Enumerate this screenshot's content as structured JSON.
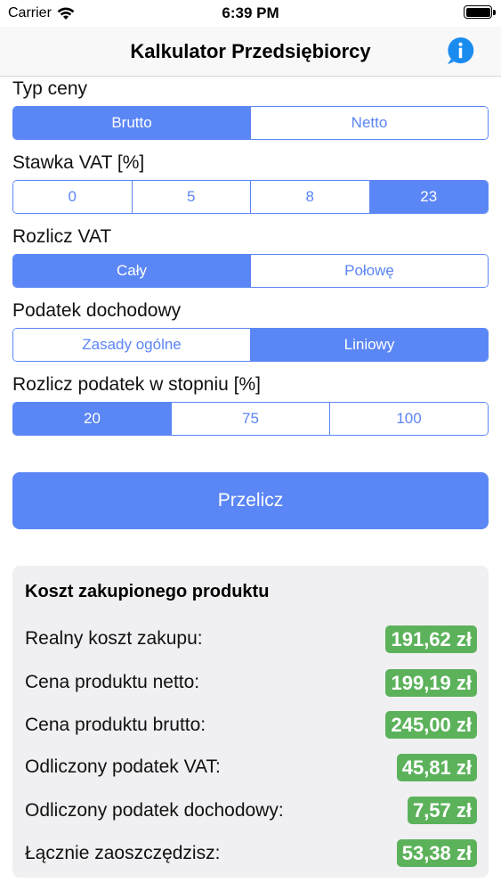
{
  "status_bar": {
    "carrier": "Carrier",
    "time": "6:39 PM"
  },
  "nav": {
    "title": "Kalkulator Przedsiębiorcy",
    "info_icon": "info-circle-icon"
  },
  "price_type": {
    "label": "Typ ceny",
    "options": [
      "Brutto",
      "Netto"
    ],
    "selected": "Brutto"
  },
  "vat_rate": {
    "label": "Stawka VAT [%]",
    "options": [
      "0",
      "5",
      "8",
      "23"
    ],
    "selected": "23"
  },
  "vat_settle": {
    "label": "Rozlicz VAT",
    "options": [
      "Cały",
      "Połowę"
    ],
    "selected": "Cały"
  },
  "income_tax": {
    "label": "Podatek dochodowy",
    "options": [
      "Zasady ogólne",
      "Liniowy"
    ],
    "selected": "Liniowy"
  },
  "tax_degree": {
    "label": "Rozlicz podatek w stopniu [%]",
    "options": [
      "20",
      "75",
      "100"
    ],
    "selected": "20"
  },
  "calculate_button": "Przelicz",
  "results": {
    "title": "Koszt zakupionego produktu",
    "rows": [
      {
        "label": "Realny koszt zakupu:",
        "value": "191,62 zł"
      },
      {
        "label": "Cena produktu netto:",
        "value": "199,19 zł"
      },
      {
        "label": "Cena produktu brutto:",
        "value": "245,00 zł"
      },
      {
        "label": "Odliczony podatek VAT:",
        "value": "45,81 zł"
      },
      {
        "label": "Odliczony podatek dochodowy:",
        "value": "7,57 zł"
      },
      {
        "label": "Łącznie zaoszczędzisz:",
        "value": "53,38 zł"
      }
    ]
  },
  "colors": {
    "accent": "#5b86f5",
    "value_badge": "#5cb25b",
    "info_icon": "#1a8cf0"
  }
}
